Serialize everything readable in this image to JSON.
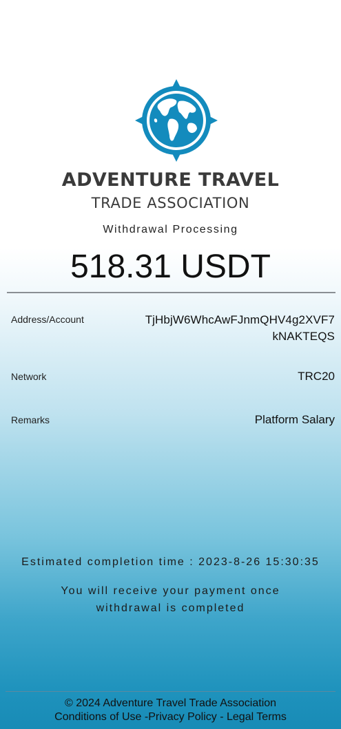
{
  "brand": {
    "line1": "ADVENTURE TRAVEL",
    "line2": "TRADE ASSOCIATION",
    "logo_icon": "globe-compass-icon",
    "logo_color": "#138bbd"
  },
  "status": "Withdrawal Processing",
  "amount": "518.31 USDT",
  "details": {
    "address_label": "Address/Account",
    "address_value": "TjHbjW6WhcAwFJnmQHV4g2XVF7kNAKTEQS",
    "network_label": "Network",
    "network_value": "TRC20",
    "remarks_label": "Remarks",
    "remarks_value": "Platform Salary"
  },
  "estimate": "Estimated completion time : 2023-8-26 15:30:35",
  "notice": "You will receive your payment once withdrawal is completed",
  "footer": {
    "copyright": "© 2024 Adventure Travel Trade Association",
    "links": "Conditions of Use -Privacy Policy - Legal Terms"
  }
}
